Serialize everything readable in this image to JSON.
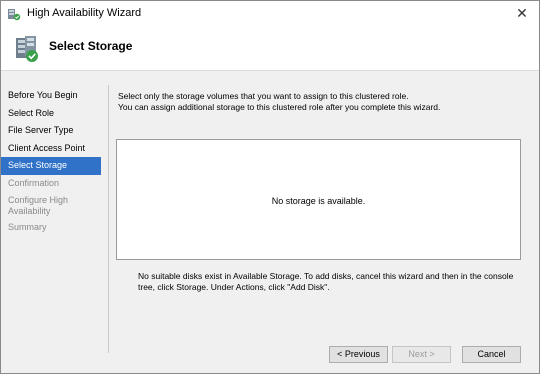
{
  "window": {
    "title": "High Availability Wizard",
    "close_glyph": "✕"
  },
  "header": {
    "title": "Select Storage",
    "icon": "cluster-wizard-icon"
  },
  "nav": {
    "items": [
      {
        "label": "Before You Begin",
        "state": "normal"
      },
      {
        "label": "Select Role",
        "state": "normal"
      },
      {
        "label": "File Server Type",
        "state": "normal"
      },
      {
        "label": "Client Access Point",
        "state": "normal"
      },
      {
        "label": "Select Storage",
        "state": "selected"
      },
      {
        "label": "Confirmation",
        "state": "disabled"
      },
      {
        "label": "Configure High Availability",
        "state": "disabled"
      },
      {
        "label": "Summary",
        "state": "disabled"
      }
    ]
  },
  "main": {
    "instruction_line1": "Select only the storage volumes that you want to assign to this clustered role.",
    "instruction_line2": "You can assign additional storage to this clustered role after you complete this wizard.",
    "empty_message": "No storage is available.",
    "note": "No suitable disks exist in Available Storage. To add disks, cancel this wizard and then in the console tree, click Storage. Under Actions, click \"Add Disk\"."
  },
  "buttons": {
    "previous": "< Previous",
    "next": "Next >",
    "cancel": "Cancel"
  },
  "colors": {
    "selection": "#2f72c8",
    "disabled_text": "#8a8a8a"
  }
}
